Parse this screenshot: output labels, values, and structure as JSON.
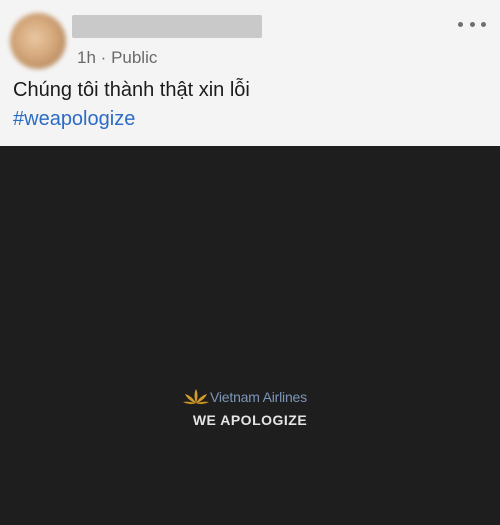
{
  "post": {
    "meta_time": "1h",
    "meta_separator": "·",
    "meta_visibility": "Public",
    "text": "Chúng tôi thành thật xin lỗi",
    "hashtag": "#weapologize"
  },
  "media": {
    "brand_name": "Vietnam Airlines",
    "caption": "WE APOLOGIZE",
    "colors": {
      "background": "#1e1e1e",
      "lotus": "#d49a2c",
      "brand_text": "#7d96b8",
      "caption_text": "#e4e4e4"
    }
  },
  "icons": {
    "more": "more-horizontal-icon",
    "brand_logo": "lotus-logo-icon"
  },
  "colors": {
    "hashtag": "#2b6cc4",
    "meta": "#6a6a6a"
  }
}
